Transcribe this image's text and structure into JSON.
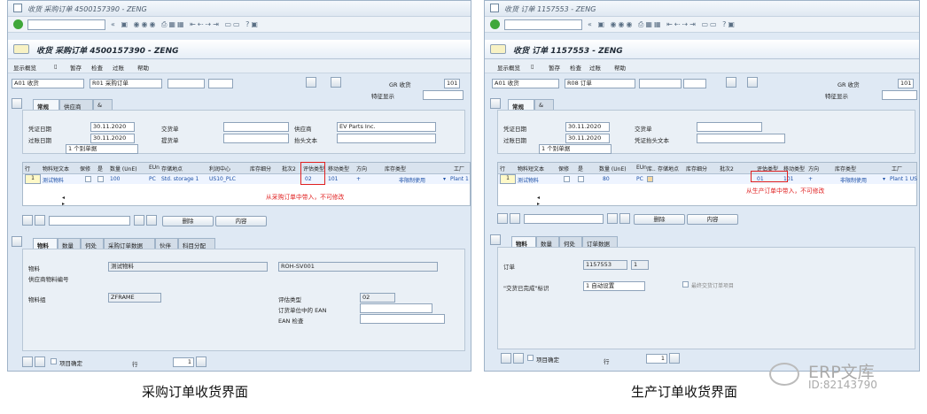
{
  "left": {
    "window_title": "收货 采购订单 4500157390 - ZENG",
    "page_title": "收货 采购订单 4500157390 - ZENG",
    "app_toolbar": [
      "显示概览",
      "暂存",
      "检查",
      "过账",
      "帮助"
    ],
    "action": "A01 收货",
    "ref_doc": "R01 采购订单",
    "gr_label": "GR 收货",
    "mvt": "101",
    "special_stock_label": "特征显示",
    "main_tabs": [
      "常规",
      "供应商"
    ],
    "doc_date_label": "凭证日期",
    "doc_date": "30.11.2020",
    "post_date_label": "过账日期",
    "post_date": "30.11.2020",
    "slip_label": "1 个别单据",
    "delivery_note_label": "交货单",
    "bol_label": "提货单",
    "vendor_label": "供应商",
    "vendor": "EV Parts Inc.",
    "header_text_label": "抬头文本",
    "columns": [
      "行",
      "物料短文本",
      "保修",
      "是",
      "数量 (UnE)",
      "EUn",
      "存储地点",
      "利润中心",
      "库存细分",
      "批次2",
      "评估类型",
      "移动类型",
      "方向",
      "库存类型",
      "工厂"
    ],
    "row": {
      "line": "1",
      "text": "测试物料",
      "qty": "100",
      "eun": "PC",
      "sloc": "Std. storage 1",
      "profit": "US10_PLC",
      "valtype": "02",
      "mvt": "101",
      "dir": "+",
      "stocktype": "非限制使用",
      "plant": "Plant 1"
    },
    "annotation": "从采购订单中带入，不可修改",
    "btn_delete": "删除",
    "btn_content": "内容",
    "detail_tabs": [
      "物料",
      "数量",
      "何处",
      "采购订单数据",
      "伙伴",
      "科目分配"
    ],
    "material_label": "物料",
    "material_desc": "测试物料",
    "material_no": "ROH-SV001",
    "vendor_mat_label": "供应商物料编号",
    "mat_group_label": "物料组",
    "mat_group": "ZFRAME",
    "valtype_label": "评估类型",
    "valtype": "02",
    "ean_label": "订货单位中的 EAN",
    "ean_check_label": "EAN 检查",
    "item_ok_label": "项目确定",
    "line_label": "行",
    "line_value": "1"
  },
  "right": {
    "window_title": "收货 订单 1157553 - ZENG",
    "page_title": "收货 订单 1157553 - ZENG",
    "app_toolbar": [
      "显示概览",
      "暂存",
      "检查",
      "过账",
      "帮助"
    ],
    "action": "A01 收货",
    "ref_doc": "R08 订单",
    "gr_label": "GR 收货",
    "mvt": "101",
    "special_stock_label": "特征显示",
    "main_tabs": [
      "常规"
    ],
    "doc_date_label": "凭证日期",
    "doc_date": "30.11.2020",
    "post_date_label": "过账日期",
    "post_date": "30.11.2020",
    "slip_label": "1 个别单据",
    "delivery_note_label": "交货单",
    "header_text_label": "凭证抬头文本",
    "columns": [
      "行",
      "物料短文本",
      "保修",
      "是",
      "数量 (UnE)",
      "EUn",
      "库..",
      "存储地点",
      "库存细分",
      "批次2",
      "评估类型",
      "移动类型",
      "方向",
      "库存类型",
      "工厂"
    ],
    "row": {
      "line": "1",
      "text": "测试物料",
      "qty": "80",
      "eun": "PC",
      "valtype": "01",
      "mvt": "101",
      "dir": "+",
      "stocktype": "非限制使用",
      "plant": "Plant 1 US"
    },
    "annotation": "从生产订单中带入，不可修改",
    "btn_delete": "删除",
    "btn_content": "内容",
    "detail_tabs": [
      "物料",
      "数量",
      "何处",
      "订单数据"
    ],
    "order_label": "订单",
    "order_no": "1157553",
    "order_item": "1",
    "final_label": "\"交货已完成\"标识",
    "final_value": "1 自动设置",
    "final_check_label": "最终交货订单项目",
    "item_ok_label": "项目确定",
    "line_label": "行",
    "line_value": "1"
  },
  "captions": [
    "采购订单收货界面",
    "生产订单收货界面"
  ],
  "watermark": {
    "name": "ERP文库",
    "id": "ID:82143790"
  },
  "colors": {
    "annotation": "#e02020",
    "panel": "#dfe9f4"
  }
}
